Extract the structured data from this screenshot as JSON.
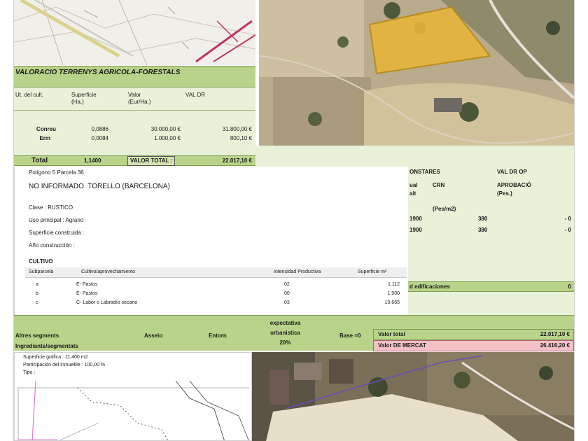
{
  "farm": {
    "title": "VALORACIO TERRENYS AGRICOLA-FORESTALS",
    "headers": [
      "Ut. del cult.",
      "Superficie (Ha.)",
      "Valor (Eur/Ha.)",
      "VAL DR"
    ],
    "rows": [
      {
        "label": "Conreu",
        "sup": "0,0886",
        "val": "30.000,00 €",
        "vd": "31.800,00 €"
      },
      {
        "label": "Erm",
        "sup": "0,0084",
        "val": "1.000,00 €",
        "vd": "800,10 €"
      }
    ],
    "total_label": "Total",
    "total_sup": "1,1400",
    "total_value_label": "VALOR TOTAL :",
    "total_value": "22.017,10 €"
  },
  "parcel": {
    "id": "Polígono 5 Parcela 36",
    "location": "NO INFORMADO. TORELLO (BARCELONA)",
    "clase": "Clase : RUSTICO",
    "uso": "Uso principal : Agrario",
    "sup_construida": "Superficie construida :",
    "ano": "Año construcción :",
    "cultivo_title": "CULTIVO",
    "cultivo_headers": [
      "Subparcela",
      "Cultivo/aprovechamiento",
      "Intensidad Productiva",
      "Superficie m²"
    ],
    "cultivo_rows": [
      {
        "sub": "a",
        "cult": "E- Pastos",
        "int": "02",
        "sup": "1.112"
      },
      {
        "sub": "b",
        "cult": "E- Pastos",
        "int": "00",
        "sup": "1.900"
      },
      {
        "sub": "c",
        "cult": "C- Labor o Labradío secano",
        "int": "03",
        "sup": "10.665"
      }
    ]
  },
  "right": {
    "h1": "ONSTARES",
    "h2": "VAL DR OP",
    "r2a": "ual",
    "r2b": "CRN",
    "r2c": "APROBACIÓ",
    "r3a": "ait",
    "r3c": "(Pes.)",
    "r4": "(Pes/m2)",
    "rows": [
      {
        "a": "1900",
        "b": "380",
        "c": "- 0"
      },
      {
        "a": "1900",
        "b": "380",
        "c": "- 0"
      }
    ],
    "bar_label": "d edificaciones",
    "bar_value": "0"
  },
  "bottom": {
    "c1": "Altres segments",
    "c2": "Asseio",
    "c3": "Entorn",
    "c4_lines": [
      "expectativa",
      "urbanistica",
      "20%"
    ],
    "c5": "Base =0",
    "sub": "Ingrediants/segmentats",
    "val_label": "Valor total",
    "val_value": "22.017,10 €",
    "market_label": "Valor DE MERCAT",
    "market_value": "26.416,20 €"
  },
  "plan": {
    "line1": "Superficie gráfica : 11.400 m2",
    "line2": "Participación del inmueble : 100,00 %",
    "line3": "Tipo :"
  }
}
